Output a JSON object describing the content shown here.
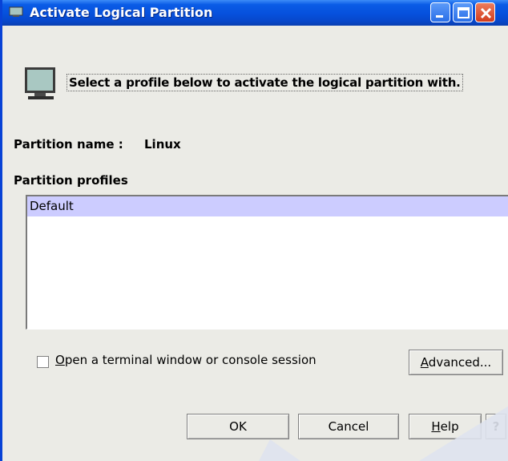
{
  "window": {
    "title": "Activate Logical Partition",
    "controls": [
      "minimize",
      "maximize",
      "close"
    ]
  },
  "header": {
    "icon": "monitor-icon",
    "instruction": "Select a profile below to activate the logical partition with."
  },
  "partition": {
    "name_label": "Partition name :",
    "name_value": "Linux"
  },
  "profiles": {
    "label": "Partition profiles",
    "items": [
      {
        "label": "Default",
        "selected": true
      }
    ]
  },
  "options": {
    "terminal_checkbox": {
      "label_mnemonic": "O",
      "label_rest": "pen a terminal window or console session",
      "checked": false
    },
    "advanced_button": {
      "mnemonic": "A",
      "rest": "dvanced..."
    }
  },
  "buttons": {
    "ok": "OK",
    "cancel": "Cancel",
    "help_mnemonic": "H",
    "help_rest": "elp",
    "context_help": "?"
  },
  "colors": {
    "titlebar": "#0650dc",
    "selection": "#ccccff",
    "dialog_bg": "#ebebe6"
  }
}
